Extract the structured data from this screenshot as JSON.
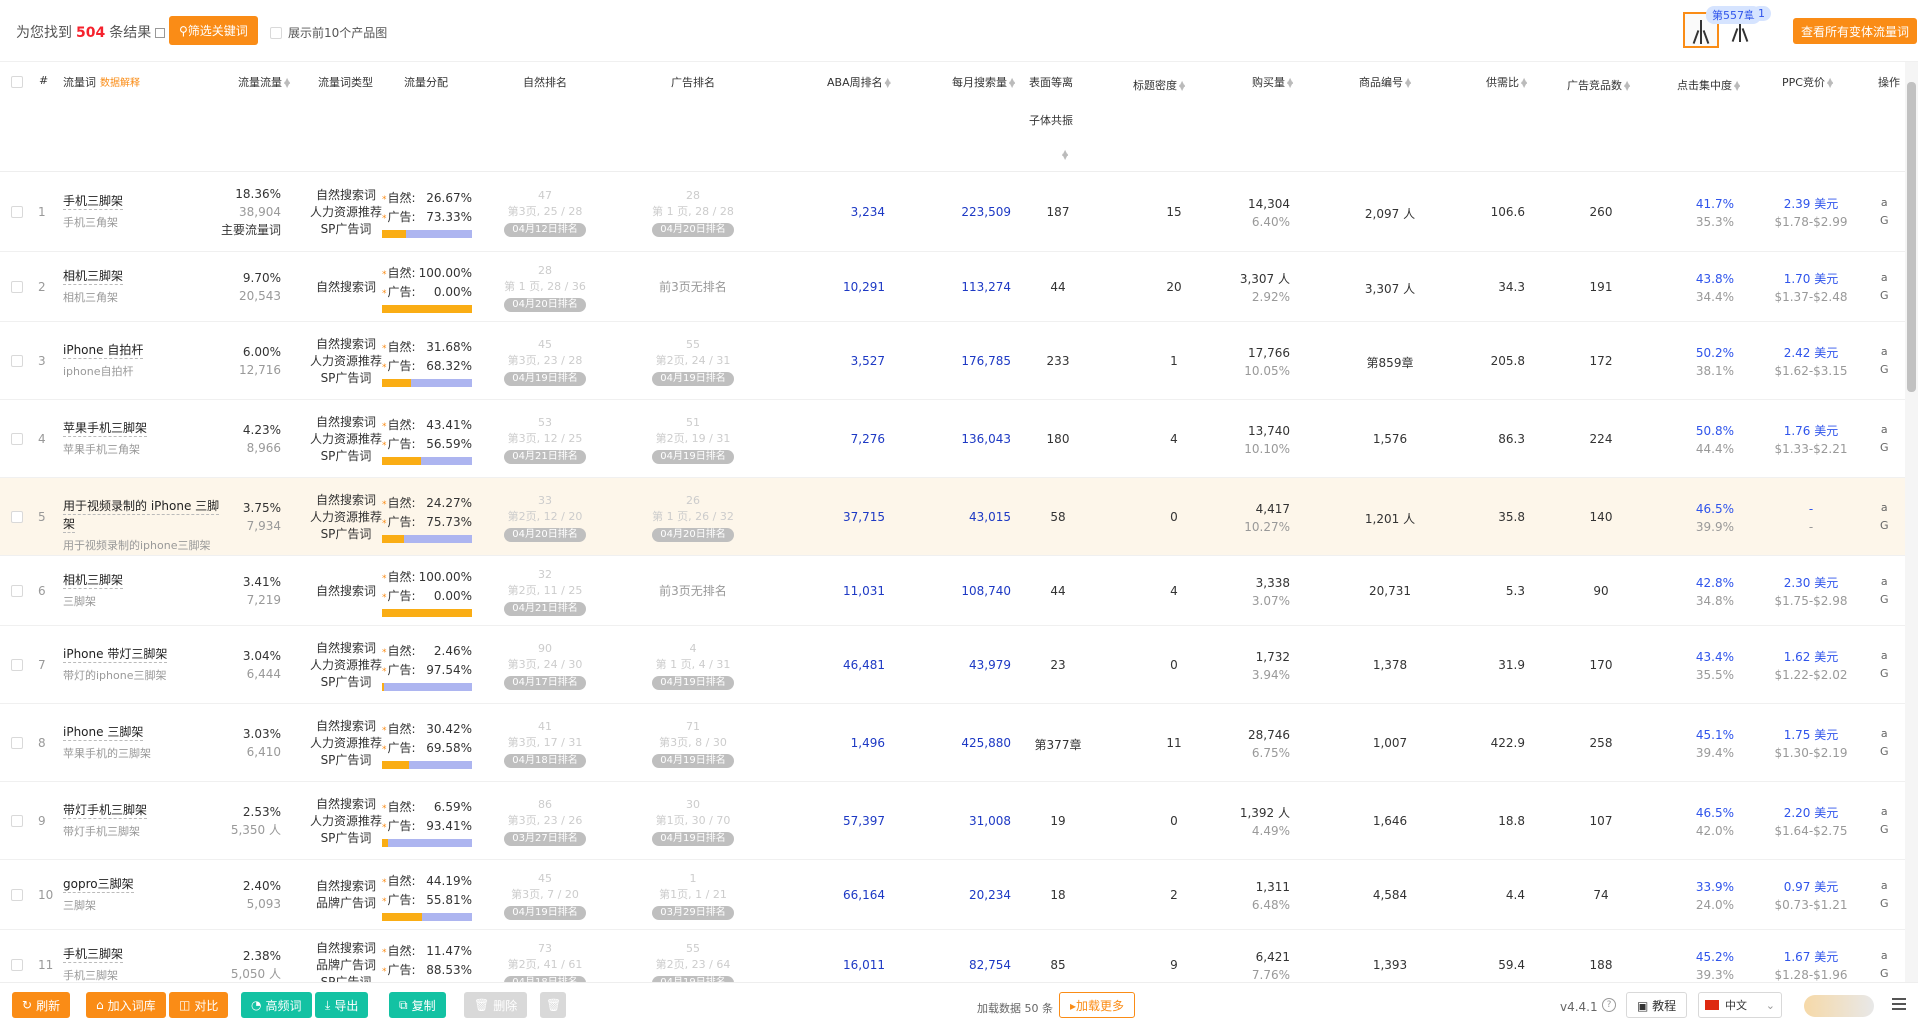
{
  "top": {
    "result_prefix": "为您找到",
    "result_count": "504",
    "result_suffix": "条结果",
    "filter_button": "筛选关键词",
    "show_top10": "展示前10个产品图",
    "rank_badge": "第557章",
    "rank_badge_count": "1",
    "view_variants": "查看所有变体流量词"
  },
  "headers": {
    "index": "#",
    "keyword": "流量词",
    "keyword_hint": "数据解释",
    "traffic_share": "流量流量",
    "keyword_type": "流量词类型",
    "distribution": "流量分配",
    "organic_rank": "自然排名",
    "ad_rank": "广告排名",
    "aba_rank": "ABA周排名",
    "monthly_search": "每月搜索量",
    "surface_line1": "表面等离",
    "surface_line2": "子体共振",
    "title_density": "标题密度",
    "purchases": "购买量",
    "product_code": "商品编号",
    "supply_ratio": "供需比",
    "ad_products": "广告竞品数",
    "click_concentration": "点击集中度",
    "ppc": "PPC竞价",
    "action": "操作"
  },
  "labels": {
    "natural": "自然:",
    "ad": "广告:",
    "action_a": "a",
    "action_g": "G"
  },
  "rows": [
    {
      "idx": "1",
      "kw": "手机三脚架",
      "sub": "手机三角架",
      "share": "18.36%",
      "traffic": "38,904",
      "main": "主要流量词",
      "types": [
        "自然搜索词",
        "人力资源推荐",
        "SP广告词"
      ],
      "nat": "26.67%",
      "ad": "73.33%",
      "nat_frac": 0.2667,
      "or_top": "47",
      "or_mid": "第3页, 25 / 28",
      "or_tag": "04月12日排名",
      "ar_top": "28",
      "ar_mid": "第 1 页, 28 / 28",
      "ar_tag": "04月20日排名",
      "aba": "3,234",
      "month": "223,509",
      "surface": "187",
      "density": "15",
      "buy": "14,304",
      "buy_pct": "6.40%",
      "code": "2,097 人",
      "supply": "106.6",
      "adprod": "260",
      "click1": "41.7%",
      "click2": "35.3%",
      "ppc1": "2.39 美元",
      "ppc2": "$1.78-$2.99"
    },
    {
      "idx": "2",
      "kw": "相机三脚架",
      "sub": "相机三角架",
      "share": "9.70%",
      "traffic": "20,543",
      "main": "",
      "types": [
        "自然搜索词"
      ],
      "nat": "100.00%",
      "ad": "0.00%",
      "nat_frac": 1.0,
      "or_top": "28",
      "or_mid": "第 1 页, 28 / 36",
      "or_tag": "04月20日排名",
      "ar_top": "",
      "ar_mid": "前3页无排名",
      "ar_tag": "",
      "aba": "10,291",
      "month": "113,274",
      "surface": "44",
      "density": "20",
      "buy": "3,307 人",
      "buy_pct": "2.92%",
      "code": "3,307 人",
      "supply": "34.3",
      "adprod": "191",
      "click1": "43.8%",
      "click2": "34.4%",
      "ppc1": "1.70 美元",
      "ppc2": "$1.37-$2.48"
    },
    {
      "idx": "3",
      "kw": "iPhone 自拍杆",
      "sub": "iphone自拍杆",
      "share": "6.00%",
      "traffic": "12,716",
      "main": "",
      "types": [
        "自然搜索词",
        "人力资源推荐",
        "SP广告词"
      ],
      "nat": "31.68%",
      "ad": "68.32%",
      "nat_frac": 0.3168,
      "or_top": "45",
      "or_mid": "第3页, 23 / 28",
      "or_tag": "04月19日排名",
      "ar_top": "55",
      "ar_mid": "第2页, 24 / 31",
      "ar_tag": "04月19日排名",
      "aba": "3,527",
      "month": "176,785",
      "surface": "233",
      "density": "1",
      "buy": "17,766",
      "buy_pct": "10.05%",
      "code": "第859章",
      "supply": "205.8",
      "adprod": "172",
      "click1": "50.2%",
      "click2": "38.1%",
      "ppc1": "2.42 美元",
      "ppc2": "$1.62-$3.15"
    },
    {
      "idx": "4",
      "kw": "苹果手机三脚架",
      "sub": "苹果手机三角架",
      "share": "4.23%",
      "traffic": "8,966",
      "main": "",
      "types": [
        "自然搜索词",
        "人力资源推荐",
        "SP广告词"
      ],
      "nat": "43.41%",
      "ad": "56.59%",
      "nat_frac": 0.4341,
      "or_top": "53",
      "or_mid": "第3页, 12 / 25",
      "or_tag": "04月21日排名",
      "ar_top": "51",
      "ar_mid": "第2页, 19 / 31",
      "ar_tag": "04月19日排名",
      "aba": "7,276",
      "month": "136,043",
      "surface": "180",
      "density": "4",
      "buy": "13,740",
      "buy_pct": "10.10%",
      "code": "1,576",
      "supply": "86.3",
      "adprod": "224",
      "click1": "50.8%",
      "click2": "44.4%",
      "ppc1": "1.76 美元",
      "ppc2": "$1.33-$2.21"
    },
    {
      "idx": "5",
      "kw": "用于视频录制的 iPhone 三脚",
      "kw2": "架",
      "sub": "用于视频录制的iphone三脚架",
      "share": "3.75%",
      "traffic": "7,934",
      "main": "",
      "types": [
        "自然搜索词",
        "人力资源推荐",
        "SP广告词"
      ],
      "nat": "24.27%",
      "ad": "75.73%",
      "nat_frac": 0.2427,
      "or_top": "33",
      "or_mid": "第2页, 12 / 20",
      "or_tag": "04月20日排名",
      "ar_top": "26",
      "ar_mid": "第 1 页, 26 / 32",
      "ar_tag": "04月20日排名",
      "aba": "37,715",
      "month": "43,015",
      "surface": "58",
      "density": "0",
      "buy": "4,417",
      "buy_pct": "10.27%",
      "code": "1,201 人",
      "supply": "35.8",
      "adprod": "140",
      "click1": "46.5%",
      "click2": "39.9%",
      "ppc1": "-",
      "ppc2": "-"
    },
    {
      "idx": "6",
      "kw": "相机三脚架",
      "sub": "三脚架",
      "share": "3.41%",
      "traffic": "7,219",
      "main": "",
      "types": [
        "自然搜索词"
      ],
      "nat": "100.00%",
      "ad": "0.00%",
      "nat_frac": 1.0,
      "or_top": "32",
      "or_mid": "第2页, 11 / 25",
      "or_tag": "04月21日排名",
      "ar_top": "",
      "ar_mid": "前3页无排名",
      "ar_tag": "",
      "aba": "11,031",
      "month": "108,740",
      "surface": "44",
      "density": "4",
      "buy": "3,338",
      "buy_pct": "3.07%",
      "code": "20,731",
      "supply": "5.3",
      "adprod": "90",
      "click1": "42.8%",
      "click2": "34.8%",
      "ppc1": "2.30 美元",
      "ppc2": "$1.75-$2.98"
    },
    {
      "idx": "7",
      "kw": "iPhone 带灯三脚架",
      "sub": "带灯的iphone三脚架",
      "share": "3.04%",
      "traffic": "6,444",
      "main": "",
      "types": [
        "自然搜索词",
        "人力资源推荐",
        "SP广告词"
      ],
      "nat": "2.46%",
      "ad": "97.54%",
      "nat_frac": 0.0246,
      "or_top": "90",
      "or_mid": "第3页, 24 / 30",
      "or_tag": "04月17日排名",
      "ar_top": "4",
      "ar_mid": "第 1 页, 4 / 31",
      "ar_tag": "04月19日排名",
      "aba": "46,481",
      "month": "43,979",
      "surface": "23",
      "density": "0",
      "buy": "1,732",
      "buy_pct": "3.94%",
      "code": "1,378",
      "supply": "31.9",
      "adprod": "170",
      "click1": "43.4%",
      "click2": "35.5%",
      "ppc1": "1.62 美元",
      "ppc2": "$1.22-$2.02"
    },
    {
      "idx": "8",
      "kw": "iPhone 三脚架",
      "sub": "苹果手机的三脚架",
      "share": "3.03%",
      "traffic": "6,410",
      "main": "",
      "types": [
        "自然搜索词",
        "人力资源推荐",
        "SP广告词"
      ],
      "nat": "30.42%",
      "ad": "69.58%",
      "nat_frac": 0.3042,
      "or_top": "41",
      "or_mid": "第3页, 17 / 31",
      "or_tag": "04月18日排名",
      "ar_top": "71",
      "ar_mid": "第3页, 8 / 30",
      "ar_tag": "04月19日排名",
      "aba": "1,496",
      "month": "425,880",
      "surface": "第377章",
      "density": "11",
      "buy": "28,746",
      "buy_pct": "6.75%",
      "code": "1,007",
      "supply": "422.9",
      "adprod": "258",
      "click1": "45.1%",
      "click2": "39.4%",
      "ppc1": "1.75 美元",
      "ppc2": "$1.30-$2.19"
    },
    {
      "idx": "9",
      "kw": "带灯手机三脚架",
      "sub": "带灯手机三脚架",
      "share": "2.53%",
      "traffic": "5,350 人",
      "main": "",
      "types": [
        "自然搜索词",
        "人力资源推荐",
        "SP广告词"
      ],
      "nat": "6.59%",
      "ad": "93.41%",
      "nat_frac": 0.0659,
      "or_top": "86",
      "or_mid": "第3页, 23 / 26",
      "or_tag": "03月27日排名",
      "ar_top": "30",
      "ar_mid": "第1页, 30 / 70",
      "ar_tag": "04月19日排名",
      "aba": "57,397",
      "month": "31,008",
      "surface": "19",
      "density": "0",
      "buy": "1,392 人",
      "buy_pct": "4.49%",
      "code": "1,646",
      "supply": "18.8",
      "adprod": "107",
      "click1": "46.5%",
      "click2": "42.0%",
      "ppc1": "2.20 美元",
      "ppc2": "$1.64-$2.75"
    },
    {
      "idx": "10",
      "kw": "gopro三脚架",
      "sub": "三脚架",
      "share": "2.40%",
      "traffic": "5,093",
      "main": "",
      "types": [
        "自然搜索词",
        "品牌广告词"
      ],
      "nat": "44.19%",
      "ad": "55.81%",
      "nat_frac": 0.4419,
      "or_top": "45",
      "or_mid": "第3页, 7 / 20",
      "or_tag": "04月19日排名",
      "ar_top": "1",
      "ar_mid": "第1页, 1 / 21",
      "ar_tag": "03月29日排名",
      "aba": "66,164",
      "month": "20,234",
      "surface": "18",
      "density": "2",
      "buy": "1,311",
      "buy_pct": "6.48%",
      "code": "4,584",
      "supply": "4.4",
      "adprod": "74",
      "click1": "33.9%",
      "click2": "24.0%",
      "ppc1": "0.97 美元",
      "ppc2": "$0.73-$1.21"
    },
    {
      "idx": "11",
      "kw": "手机三脚架",
      "sub": "手机三脚架",
      "share": "2.38%",
      "traffic": "5,050 人",
      "main": "",
      "types": [
        "自然搜索词",
        "品牌广告词",
        "SP广告词"
      ],
      "nat": "11.47%",
      "ad": "88.53%",
      "nat_frac": 0.1147,
      "or_top": "73",
      "or_mid": "第2页, 41 / 61",
      "or_tag": "04月18日排名",
      "ar_top": "55",
      "ar_mid": "第2页, 23 / 64",
      "ar_tag": "04月19日排名",
      "aba": "16,011",
      "month": "82,754",
      "surface": "85",
      "density": "9",
      "buy": "6,421",
      "buy_pct": "7.76%",
      "code": "1,393",
      "supply": "59.4",
      "adprod": "188",
      "click1": "45.2%",
      "click2": "39.3%",
      "ppc1": "1.67 美元",
      "ppc2": "$1.28-$1.96"
    }
  ],
  "footer": {
    "refresh": "刷新",
    "add_lib": "加入词库",
    "compare": "对比",
    "high_freq": "高频词",
    "export": "导出",
    "copy": "复制",
    "delete": "删除",
    "loaded": "加载数据 50 条",
    "load_more": "加载更多",
    "version": "v4.4.1",
    "help": "?",
    "tutorial": "教程",
    "lang": "中文"
  },
  "colors": {
    "accent": "#fa8c16",
    "natural_bar": "#faad14",
    "ad_bar": "#adb5f0",
    "link_blue": "#1d39c4"
  }
}
